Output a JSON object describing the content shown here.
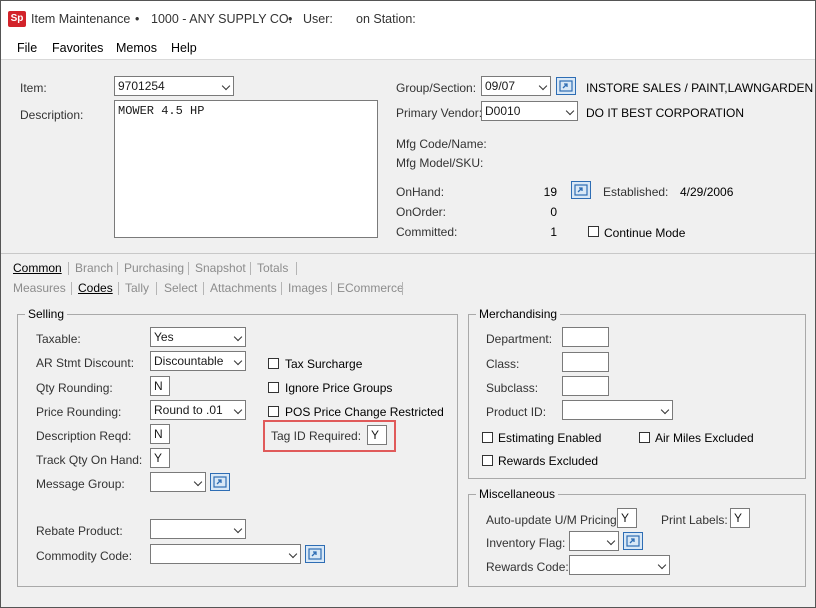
{
  "titlebar": {
    "logo": "Sp",
    "app": "Item Maintenance",
    "company": "1000 - ANY SUPPLY CO.",
    "user_label": "User:",
    "station_label": "on Station:",
    "bullet": "•"
  },
  "menu": [
    "File",
    "Favorites",
    "Memos",
    "Help"
  ],
  "item": {
    "item_label": "Item:",
    "item_value": "9701254",
    "description_label": "Description:",
    "description_value": "MOWER 4.5 HP",
    "group_label": "Group/Section:",
    "group_value": "09/07",
    "group_desc": "INSTORE SALES / PAINT,LAWNGARDEN",
    "vendor_label": "Primary Vendor:",
    "vendor_value": "D0010",
    "vendor_desc": "DO IT BEST CORPORATION",
    "mfg_code_label": "Mfg Code/Name:",
    "mfg_model_label": "Mfg Model/SKU:",
    "onhand_label": "OnHand:",
    "onhand_value": "19",
    "onorder_label": "OnOrder:",
    "onorder_value": "0",
    "committed_label": "Committed:",
    "committed_value": "1",
    "established_label": "Established:",
    "established_value": "4/29/2006",
    "continue_mode_label": "Continue Mode"
  },
  "tabs_row1": [
    {
      "label": "Common",
      "active": true
    },
    {
      "label": "Branch",
      "active": false
    },
    {
      "label": "Purchasing",
      "active": false
    },
    {
      "label": "Snapshot",
      "active": false
    },
    {
      "label": "Totals",
      "active": false
    }
  ],
  "tabs_row2": [
    {
      "label": "Measures",
      "active": false
    },
    {
      "label": "Codes",
      "active": true
    },
    {
      "label": "Tally",
      "active": false
    },
    {
      "label": "Select",
      "active": false
    },
    {
      "label": "Attachments",
      "active": false
    },
    {
      "label": "Images",
      "active": false
    },
    {
      "label": "ECommerce",
      "active": false
    }
  ],
  "selling": {
    "legend": "Selling",
    "taxable_label": "Taxable:",
    "taxable_value": "Yes",
    "ar_label": "AR Stmt Discount:",
    "ar_value": "Discountable",
    "qty_round_label": "Qty Rounding:",
    "qty_round_value": "N",
    "price_round_label": "Price Rounding:",
    "price_round_value": "Round to .01",
    "desc_reqd_label": "Description Reqd:",
    "desc_reqd_value": "N",
    "track_qty_label": "Track Qty On Hand:",
    "track_qty_value": "Y",
    "msg_group_label": "Message Group:",
    "rebate_label": "Rebate Product:",
    "commodity_label": "Commodity Code:",
    "tax_surcharge_label": "Tax Surcharge",
    "ignore_price_label": "Ignore Price Groups",
    "pos_price_label": "POS Price Change Restricted",
    "tag_id_label": "Tag ID Required:",
    "tag_id_value": "Y"
  },
  "merch": {
    "legend": "Merchandising",
    "dept_label": "Department:",
    "class_label": "Class:",
    "subclass_label": "Subclass:",
    "product_label": "Product ID:",
    "estimating_label": "Estimating Enabled",
    "air_miles_label": "Air Miles Excluded",
    "rewards_excl_label": "Rewards Excluded"
  },
  "misc": {
    "legend": "Miscellaneous",
    "autoupdate_label": "Auto-update U/M Pricing:",
    "autoupdate_value": "Y",
    "print_labels_label": "Print Labels:",
    "print_labels_value": "Y",
    "inv_flag_label": "Inventory Flag:",
    "rewards_code_label": "Rewards Code:"
  },
  "colors": {
    "logo": "#d2232a",
    "highlight": "#e05a5a",
    "lookup_border": "#2e6db4"
  },
  "icons": {
    "lookup": "lookup-arrow-icon",
    "dropdown": "chevron-down-icon"
  }
}
